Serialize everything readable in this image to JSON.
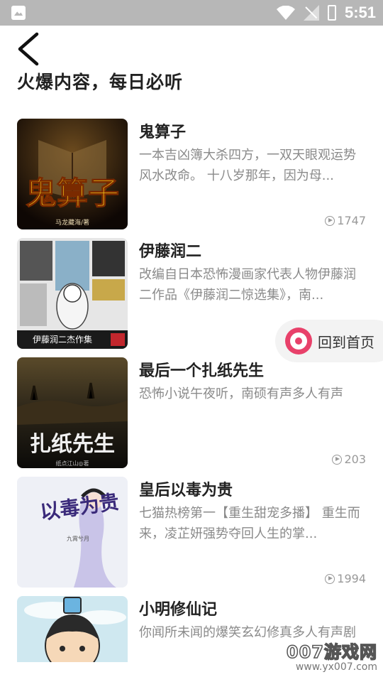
{
  "status_bar": {
    "time": "5:51"
  },
  "page": {
    "title": "火爆内容，每日必听"
  },
  "items": [
    {
      "title": "鬼算子",
      "description": "一本吉凶簿大杀四方，一双天眼观运势风水改命。 十八岁那年，因为母...",
      "plays": "1747",
      "cover_text": "鬼算子",
      "cover_author": "马龙藏海/著"
    },
    {
      "title": "伊藤润二",
      "description": "改编自日本恐怖漫画家代表人物伊藤润二作品《伊藤润二惊选集》，南...",
      "plays": "",
      "cover_text": "伊藤润二杰作集",
      "cover_author": ""
    },
    {
      "title": "最后一个扎纸先生",
      "description": "恐怖小说午夜听，南硕有声多人有声",
      "plays": "203",
      "cover_text": "扎纸先生",
      "cover_author": "纸点江山◎著"
    },
    {
      "title": "皇后以毒为贵",
      "description": "七猫热榜第一【重生甜宠多播】 重生而来，凌芷妍强势夺回人生的掌...",
      "plays": "1994",
      "cover_text": "以毒为贵",
      "cover_author": "九霄兮月"
    },
    {
      "title": "小明修仙记",
      "description": "你闻所未闻的爆笑玄幻修真多人有声剧",
      "plays": "",
      "cover_text": "",
      "cover_author": ""
    }
  ],
  "home_button": {
    "label": "回到首页"
  },
  "watermark": {
    "main": "007游戏网",
    "url": "www.yx007.com"
  },
  "colors": {
    "status_bar": "#b7b7b7",
    "accent": "#e8416a",
    "title": "#222222",
    "desc": "#8a8a8a"
  }
}
